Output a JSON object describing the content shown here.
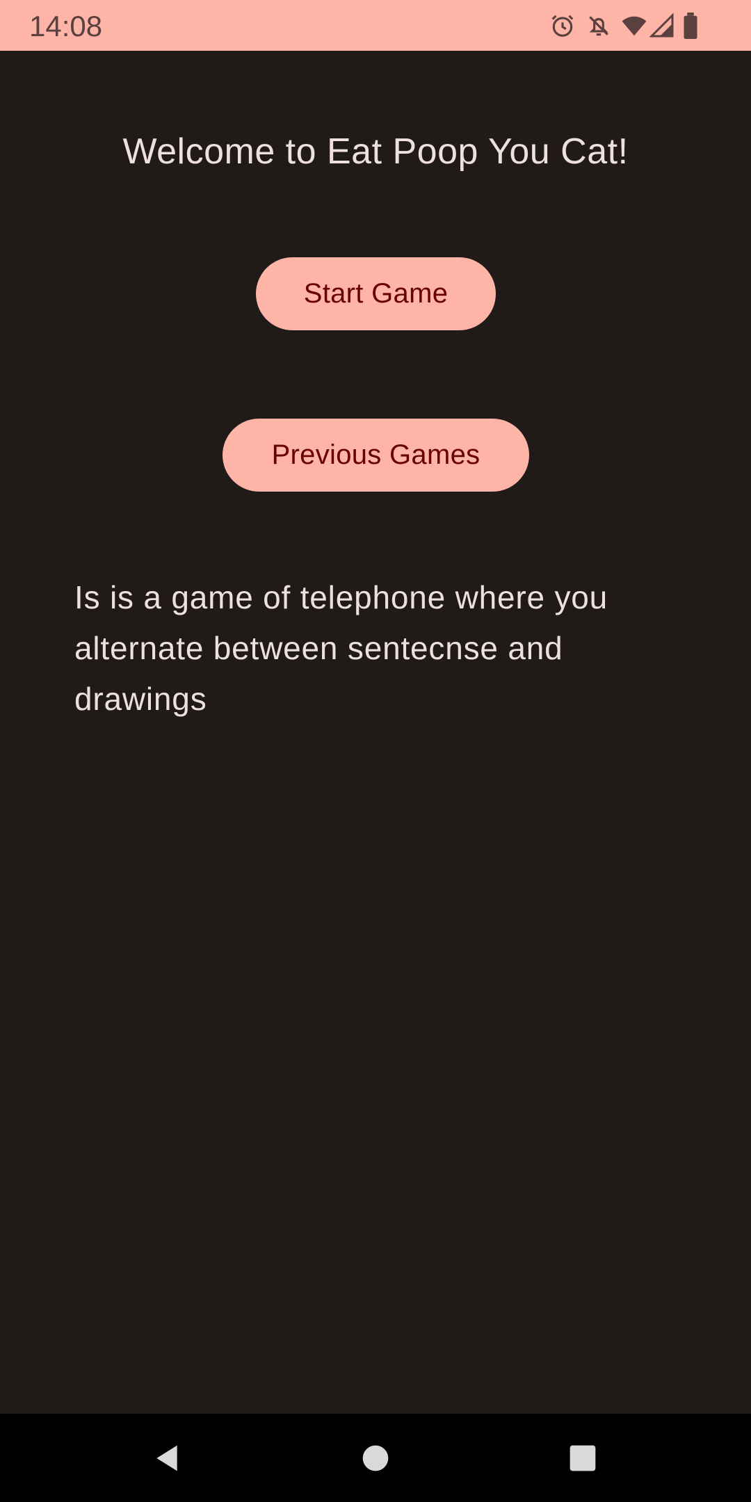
{
  "status_bar": {
    "time": "14:08",
    "icons": [
      "alarm-icon",
      "bell-off-icon",
      "wifi-icon",
      "signal-icon",
      "battery-icon"
    ]
  },
  "app": {
    "title": "Welcome to Eat Poop You Cat!",
    "start_button": "Start Game",
    "previous_button": "Previous Games",
    "description": "Is is a game of telephone where you alternate between sentecnse and drawings"
  },
  "nav_bar": {
    "icons": [
      "back-icon",
      "home-icon",
      "recents-icon"
    ]
  },
  "colors": {
    "background": "#201a19",
    "accent": "#ffb4a8",
    "button_text": "#690003",
    "text": "#ede0de"
  }
}
